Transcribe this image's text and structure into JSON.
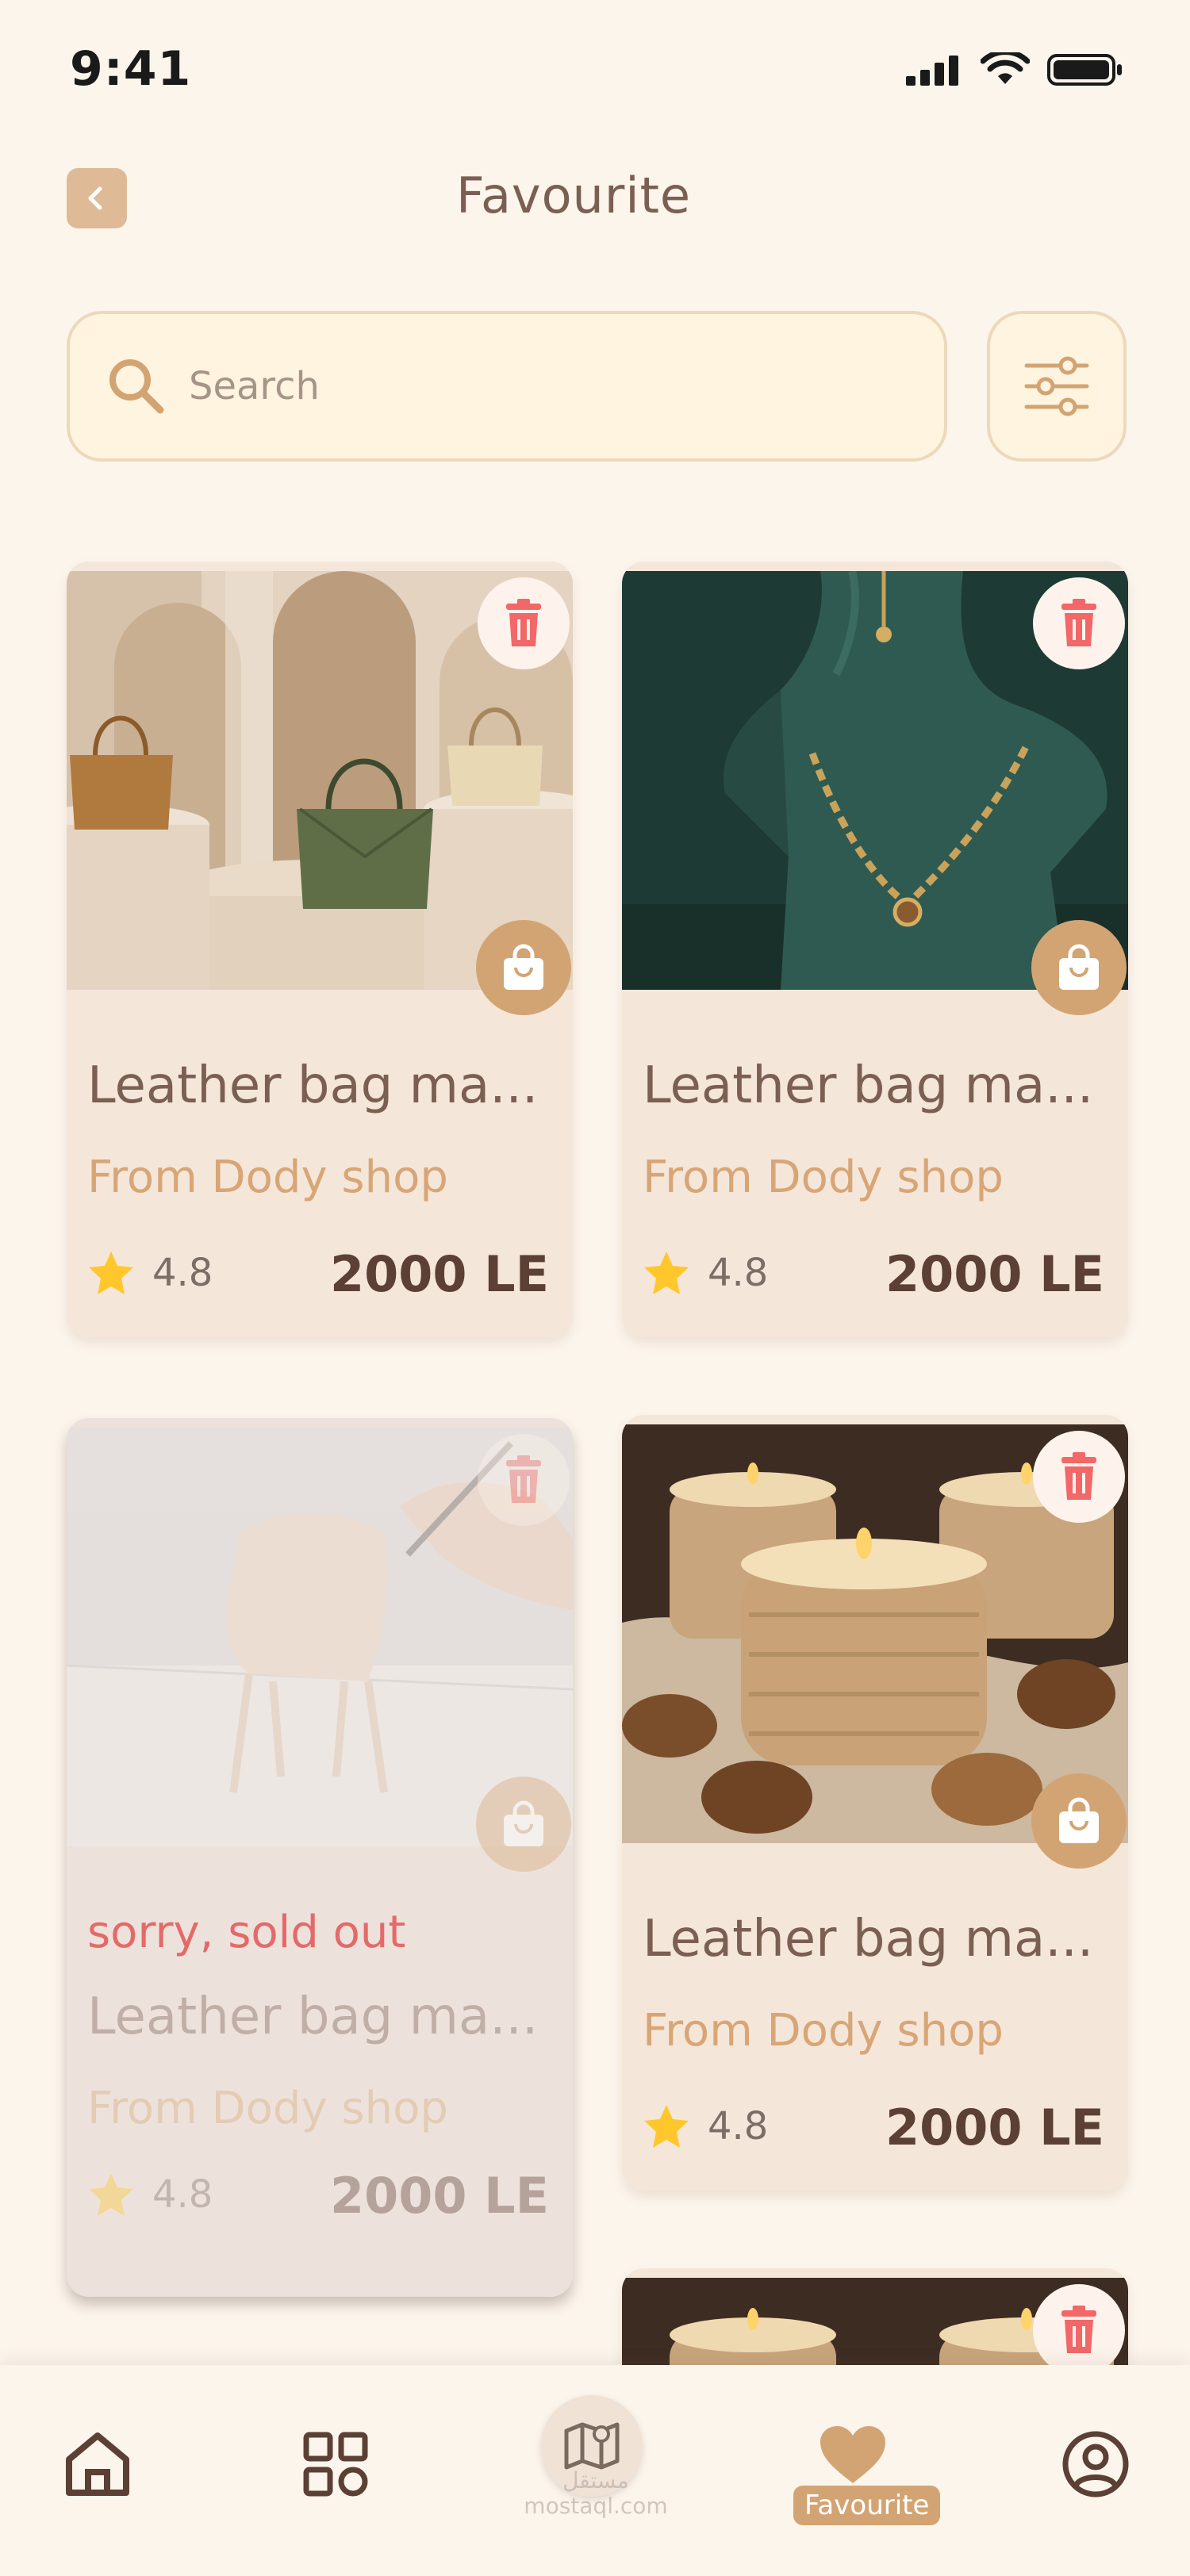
{
  "status_bar": {
    "time": "9:41"
  },
  "header": {
    "title": "Favourite"
  },
  "search": {
    "placeholder": "Search"
  },
  "products": [
    {
      "name": "Leather bag ma...",
      "shop": "From Dody shop",
      "rating": "4.8",
      "price": "2000 LE",
      "image": "leather-bags"
    },
    {
      "name": "Leather bag ma...",
      "shop": "From Dody shop",
      "rating": "4.8",
      "price": "2000 LE",
      "image": "necklace"
    },
    {
      "name": "Leather bag ma...",
      "shop": "From Dody shop",
      "rating": "4.8",
      "price": "2000 LE",
      "image": "chair-model",
      "sold_out_label": "sorry, sold out"
    },
    {
      "name": "Leather bag ma...",
      "shop": "From Dody shop",
      "rating": "4.8",
      "price": "2000 LE",
      "image": "candles"
    }
  ],
  "bottom_nav": {
    "items": [
      "home-icon",
      "grid-icon",
      "map-icon",
      "heart-icon",
      "profile-icon"
    ],
    "active_label": "Favourite",
    "watermark": [
      "مستقل",
      "mostaql.com"
    ]
  },
  "colors": {
    "background": "#FCF5EC",
    "accent": "#D3A473",
    "card": "#F5E6DA",
    "delete_red": "#F26767",
    "sold_out_red": "#E46A6A",
    "star": "#FFC72C"
  }
}
